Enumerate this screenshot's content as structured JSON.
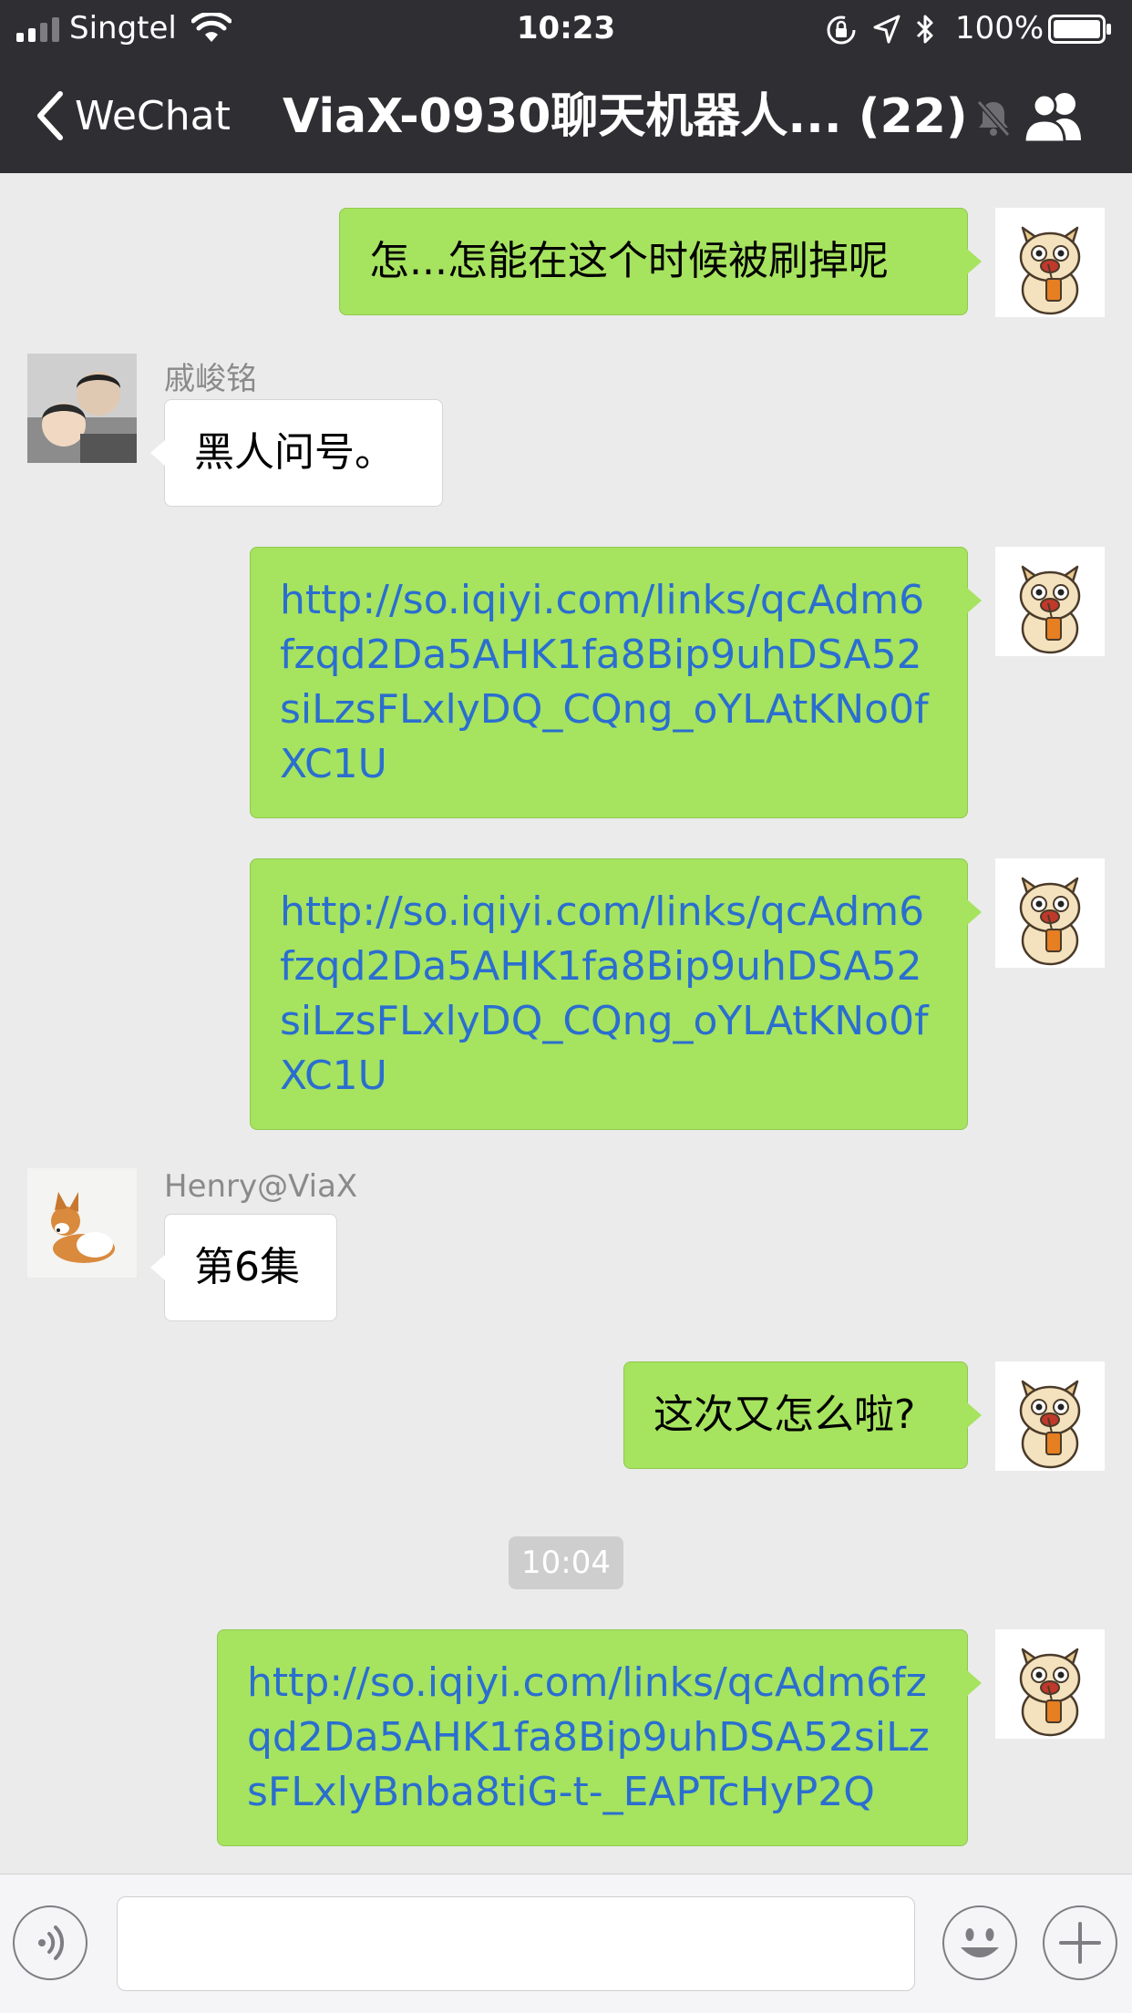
{
  "status_bar": {
    "carrier": "Singtel",
    "time": "10:23",
    "battery": "100%",
    "signal_bars_filled": 2,
    "signal_bars_total": 4
  },
  "nav": {
    "back_label": "WeChat",
    "title": "ViaX-0930聊天机器人... (22)"
  },
  "messages": [
    {
      "sender": "self",
      "text": "怎...怎能在这个时候被刷掉呢",
      "is_link": false
    },
    {
      "sender": "戚峻铭",
      "text": "黑人问号。",
      "is_link": false
    },
    {
      "sender": "self",
      "text": "http://so.iqiyi.com/links/qcAdm6fzqd2Da5AHK1fa8Bip9uhDSA52siLzsFLxlyDQ_CQng_oYLAtKNo0fXC1U",
      "is_link": true
    },
    {
      "sender": "self",
      "text": "http://so.iqiyi.com/links/qcAdm6fzqd2Da5AHK1fa8Bip9uhDSA52siLzsFLxlyDQ_CQng_oYLAtKNo0fXC1U",
      "is_link": true
    },
    {
      "sender": "Henry@ViaX",
      "text": "第6集",
      "is_link": false
    },
    {
      "sender": "self",
      "text": "这次又怎么啦?",
      "is_link": false
    },
    {
      "sender": "self",
      "text": "http://so.iqiyi.com/links/qcAdm6fzqd2Da5AHK1fa8Bip9uhDSA52siLzsFLxlyBnba8tiG-t-_EAPTcHyP2Q",
      "is_link": true
    }
  ],
  "timestamp": "10:04",
  "colors": {
    "header_bg": "#2e2e33",
    "chat_bg": "#ebebeb",
    "bubble_self": "#a6e35f",
    "bubble_other": "#ffffff",
    "link": "#2a6ed0"
  },
  "icons": {
    "back": "chevron-left-icon",
    "mute": "bell-slash-icon",
    "members": "group-icon",
    "voice": "voice-icon",
    "emoji": "emoji-icon",
    "more": "plus-icon"
  }
}
